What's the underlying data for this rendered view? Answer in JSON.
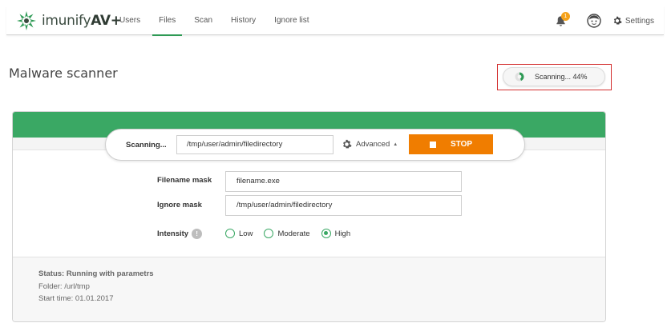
{
  "app": {
    "logo_text": "imunify",
    "logo_suffix": "AV+"
  },
  "nav": {
    "items": [
      {
        "label": "Users"
      },
      {
        "label": "Files"
      },
      {
        "label": "Scan"
      },
      {
        "label": "History"
      },
      {
        "label": "Ignore list"
      }
    ],
    "active": "Files"
  },
  "header_tools": {
    "notifications_count": "1",
    "settings_label": "Settings"
  },
  "page": {
    "title": "Malware scanner"
  },
  "scan_status": {
    "text": "Scanning... 44%",
    "progress_percent": 44
  },
  "scanner": {
    "scan_label": "Scanning...",
    "scan_path": "/tmp/user/admin/filedirectory",
    "advanced_label": "Advanced",
    "stop_label": "STOP",
    "filename_mask_label": "Filename mask",
    "filename_mask_value": "filename.exe",
    "ignore_mask_label": "Ignore mask",
    "ignore_mask_value": "/tmp/user/admin/filedirectory",
    "intensity_label": "Intensity",
    "intensity_info": "!",
    "intensity_options": [
      {
        "label": "Low",
        "checked": false
      },
      {
        "label": "Moderate",
        "checked": false
      },
      {
        "label": "High",
        "checked": true
      }
    ]
  },
  "status_info": {
    "title": "Status: Running with parametrs",
    "folder": "Folder: /url/tmp",
    "start_time": "Start time: 01.01.2017"
  },
  "colors": {
    "brand_green": "#3aa864",
    "stop_orange": "#f07d00",
    "highlight_red": "#d32f2f",
    "badge_orange": "#f5a21a"
  }
}
